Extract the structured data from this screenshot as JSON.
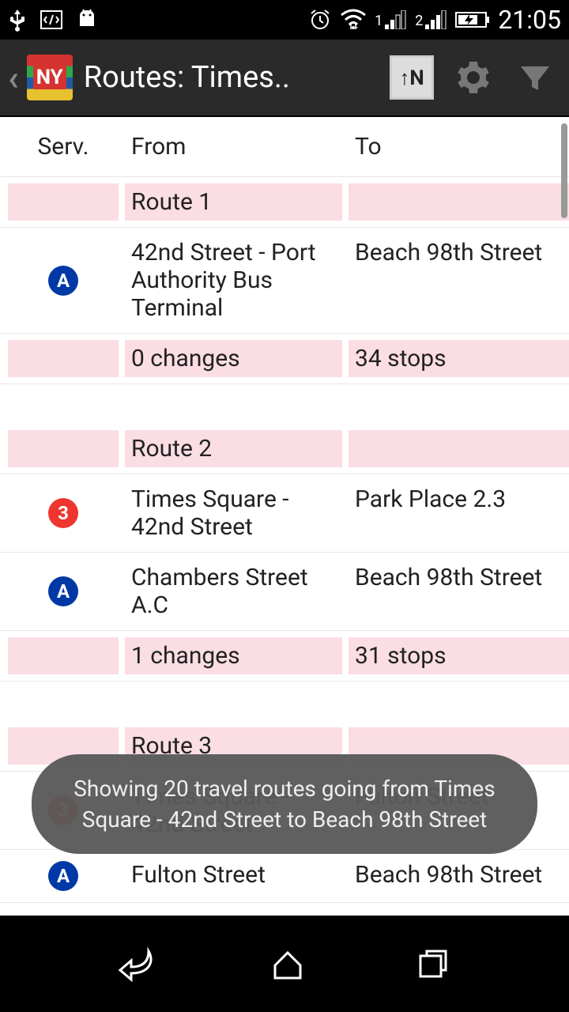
{
  "status": {
    "time": "21:05",
    "sim1": "1",
    "sim2": "2"
  },
  "appbar": {
    "icon_text": "NY",
    "title": "Routes: Times.."
  },
  "headers": {
    "serv": "Serv.",
    "from": "From",
    "to": "To"
  },
  "routes": [
    {
      "label": "Route 1",
      "legs": [
        {
          "line": "A",
          "color": "A",
          "from": "42nd Street - Port Authority Bus Terminal",
          "to": "Beach 98th Street"
        }
      ],
      "changes": "0 changes",
      "stops": "34 stops"
    },
    {
      "label": "Route 2",
      "legs": [
        {
          "line": "3",
          "color": "3",
          "from": "Times Square - 42nd Street",
          "to": "Park Place 2.3"
        },
        {
          "line": "A",
          "color": "A",
          "from": "Chambers Street A.C",
          "to": "Beach 98th Street"
        }
      ],
      "changes": "1 changes",
      "stops": "31 stops"
    },
    {
      "label": "Route 3",
      "legs": [
        {
          "line": "3",
          "color": "3",
          "from": "Times Square - 42nd Street",
          "to": "Fulton Street"
        },
        {
          "line": "A",
          "color": "A",
          "from": "Fulton Street",
          "to": "Beach 98th Street"
        }
      ],
      "changes": "",
      "stops": ""
    }
  ],
  "toast": "Showing 20 travel routes going from Times Square - 42nd Street to Beach 98th Street"
}
